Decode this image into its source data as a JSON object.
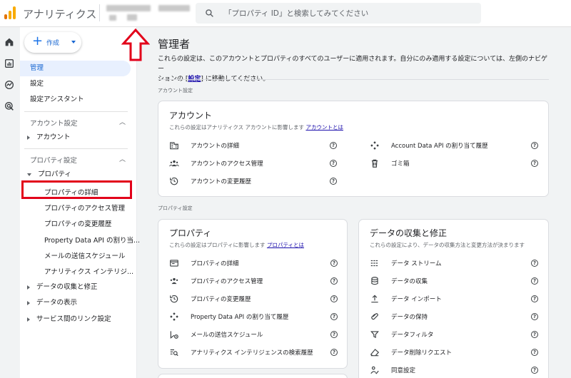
{
  "topbar": {
    "app_title": "アナリティクス",
    "search_placeholder": "「プロパティ ID」と検索してみてください",
    "logo_colors": [
      "#f9ab00",
      "#e37400",
      "#e37400"
    ]
  },
  "rail": {
    "icons": [
      "home-icon",
      "reports-icon",
      "explore-icon",
      "advertising-icon"
    ]
  },
  "sidebar": {
    "create_label": "作成",
    "admin": "管理",
    "settings": "設定",
    "setup_assistant": "設定アシスタント",
    "account_settings_header": "アカウント設定",
    "account": "アカウント",
    "property_settings_header": "プロパティ設定",
    "property": "プロパティ",
    "property_sub": [
      "プロパティの詳細",
      "プロパティのアクセス管理",
      "プロパティの変更履歴",
      "Property Data API の割り当...",
      "メールの送信スケジュール",
      "アナリティクス インテリジ..."
    ],
    "data_collection": "データの収集と修正",
    "data_display": "データの表示",
    "service_links": "サービス間のリンク設定"
  },
  "main": {
    "title": "管理者",
    "intro_line1": "これらの設定は、このアカウントとプロパティのすべてのユーザーに適用されます。自分にのみ適用する設定については、左側のナビゲー",
    "intro_line2_pre": "ションの [",
    "intro_link": "設定",
    "intro_line2_post": "] に移動してください。",
    "account_section_label": "アカウント設定",
    "property_section_label": "プロパティ設定"
  },
  "account_card": {
    "title": "アカウント",
    "desc": "これらの設定はアナリティクス アカウントに影響します",
    "desc_link": "アカウントとは",
    "left_items": [
      "アカウントの詳細",
      "アカウントのアクセス管理",
      "アカウントの変更履歴"
    ],
    "right_items": [
      "Account Data API の割り当て履歴",
      "ゴミ箱"
    ]
  },
  "property_card": {
    "title": "プロパティ",
    "desc": "これらの設定はプロパティに影響します",
    "desc_link": "プロパティとは",
    "items": [
      "プロパティの詳細",
      "プロパティのアクセス管理",
      "プロパティの変更履歴",
      "Property Data API の割り当て履歴",
      "メールの送信スケジュール",
      "アナリティクス インテリジェンスの検索履歴"
    ]
  },
  "data_card": {
    "title": "データの収集と修正",
    "desc": "これらの設定により、データの収集方法と変更方法が決まります",
    "items": [
      "データ ストリーム",
      "データの収集",
      "データ インポート",
      "データの保持",
      "データフィルタ",
      "データ削除リクエスト",
      "同意設定"
    ]
  },
  "help_glyph": "?"
}
